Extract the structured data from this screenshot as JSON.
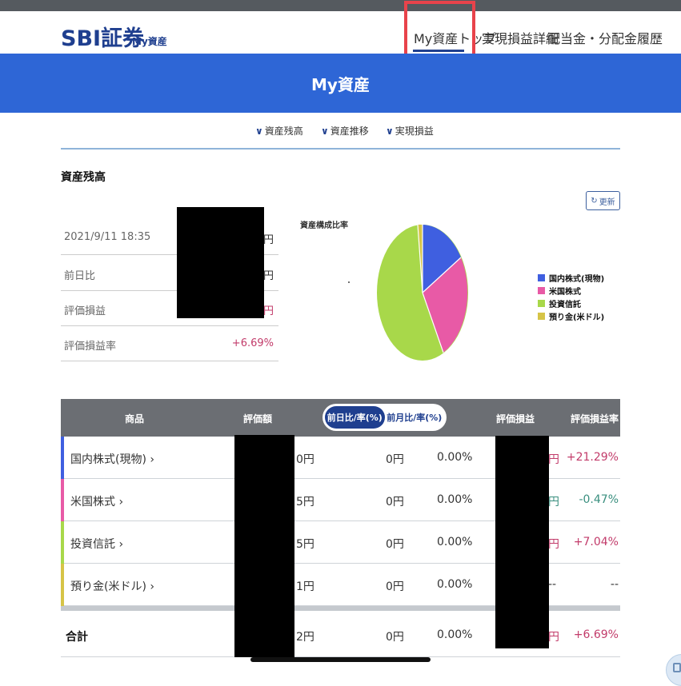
{
  "header": {
    "logo": "SBI証券",
    "logo_sub": "My資産",
    "nav": [
      {
        "label": "My資産トップ",
        "active": true
      },
      {
        "label": "実現損益詳細",
        "active": false
      },
      {
        "label": "配当金・分配金履歴",
        "active": false
      }
    ]
  },
  "banner": {
    "title": "My資産"
  },
  "anchors": [
    {
      "label": "資産残高"
    },
    {
      "label": "資産推移"
    },
    {
      "label": "実現損益"
    }
  ],
  "section": {
    "title": "資産残高",
    "refresh_label": "更新"
  },
  "summary": {
    "timestamp": "2021/9/11 18:35",
    "rows": [
      {
        "label": "前日比"
      },
      {
        "label": "評価損益"
      },
      {
        "label": "評価損益率",
        "value": "+6.69%"
      }
    ],
    "unit": "円"
  },
  "pie": {
    "title": "資産構成比率",
    "legend": [
      {
        "label": "国内株式(現物)",
        "color": "#3f5fe0"
      },
      {
        "label": "米国株式",
        "color": "#e85aa6"
      },
      {
        "label": "投資信託",
        "color": "#a8d84a"
      },
      {
        "label": "預り金(米ドル)",
        "color": "#d6c447"
      }
    ]
  },
  "table": {
    "headers": {
      "product": "商品",
      "valuation": "評価額",
      "toggle_daily": "前日比/率(%)",
      "toggle_monthly": "前月比/率(%)",
      "pnl": "評価損益",
      "pnl_rate": "評価損益率"
    },
    "rows": [
      {
        "name": "国内株式(現物)",
        "chev": "›",
        "val_tail": "0円",
        "diff": "0円",
        "rate": "0.00%",
        "pnl_tail": "円",
        "pnl_rate": "+21.29%",
        "color": "#3f5fe0"
      },
      {
        "name": "米国株式",
        "chev": "›",
        "val_tail": "5円",
        "diff": "0円",
        "rate": "0.00%",
        "pnl_tail": "円",
        "pnl_rate": "-0.47%",
        "color": "#e85aa6"
      },
      {
        "name": "投資信託",
        "chev": "›",
        "val_tail": "5円",
        "diff": "0円",
        "rate": "0.00%",
        "pnl_tail": "円",
        "pnl_rate": "+7.04%",
        "color": "#a8d84a"
      },
      {
        "name": "預り金(米ドル)",
        "chev": "›",
        "val_tail": "1円",
        "diff": "0円",
        "rate": "0.00%",
        "pnl_tail": "--",
        "pnl_rate": "--",
        "color": "#d6c447"
      }
    ],
    "total": {
      "name": "合計",
      "val_tail": "2円",
      "diff": "0円",
      "rate": "0.00%",
      "pnl_tail": "円",
      "pnl_rate": "+6.69%"
    }
  }
}
